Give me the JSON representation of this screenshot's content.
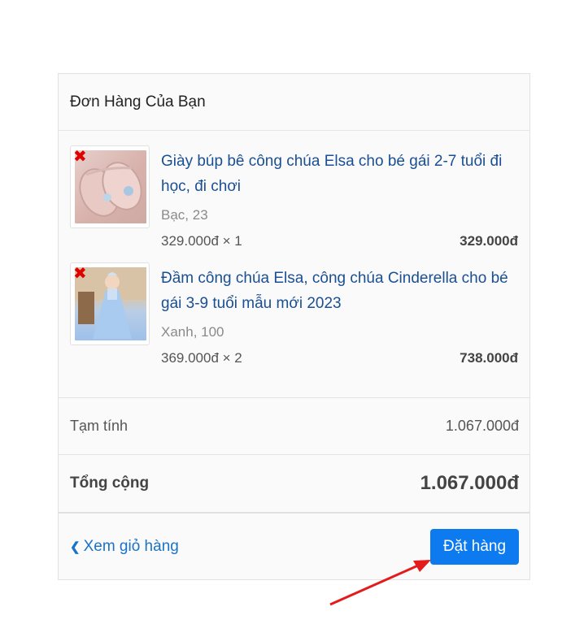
{
  "header": {
    "title": "Đơn Hàng Của Bạn"
  },
  "items": [
    {
      "image": "shoes-image",
      "title": "Giày búp bê công chúa Elsa cho bé gái 2-7 tuổi đi học, đi chơi",
      "variant": "Bạc, 23",
      "unit_qty": "329.000đ × 1",
      "line_total": "329.000đ"
    },
    {
      "image": "dress-image",
      "title": "Đầm công chúa Elsa, công chúa Cinderella cho bé gái 3-9 tuổi mẫu mới 2023",
      "variant": "Xanh, 100",
      "unit_qty": "369.000đ × 2",
      "line_total": "738.000đ"
    }
  ],
  "subtotal": {
    "label": "Tạm tính",
    "value": "1.067.000đ"
  },
  "total": {
    "label": "Tổng cộng",
    "value": "1.067.000đ"
  },
  "footer": {
    "back_icon": "chevron-left-icon",
    "back_label": "Xem giỏ hàng",
    "order_label": "Đặt hàng"
  },
  "colors": {
    "accent": "#0d7aef",
    "link": "#1a4f93",
    "arrow": "#e31b1b"
  }
}
